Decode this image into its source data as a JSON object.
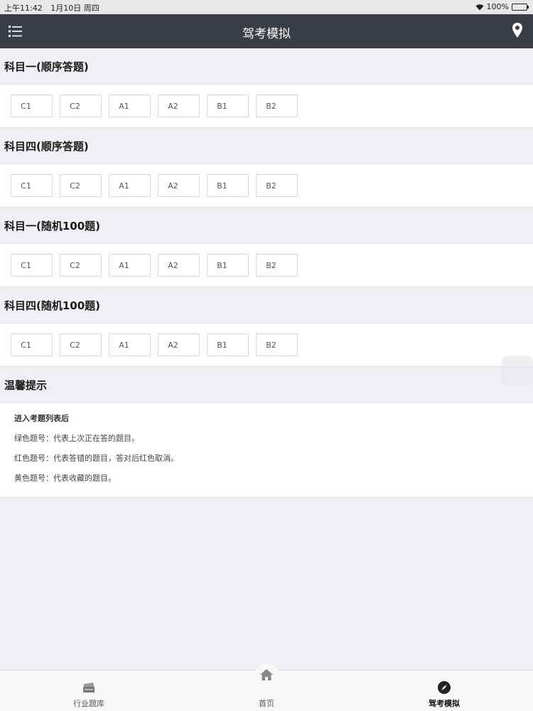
{
  "status_bar": {
    "time": "上午11:42",
    "date": "1月10日 周四",
    "battery": "100%"
  },
  "nav": {
    "title": "驾考模拟"
  },
  "sections": [
    {
      "title": "科目一(顺序答题)",
      "grades": [
        "C1",
        "C2",
        "A1",
        "A2",
        "B1",
        "B2"
      ]
    },
    {
      "title": "科目四(顺序答题)",
      "grades": [
        "C1",
        "C2",
        "A1",
        "A2",
        "B1",
        "B2"
      ]
    },
    {
      "title": "科目一(随机100题)",
      "grades": [
        "C1",
        "C2",
        "A1",
        "A2",
        "B1",
        "B2"
      ]
    },
    {
      "title": "科目四(随机100题)",
      "grades": [
        "C1",
        "C2",
        "A1",
        "A2",
        "B1",
        "B2"
      ]
    }
  ],
  "tips": {
    "title": "温馨提示",
    "lines": [
      "进入考题列表后",
      "绿色题号：代表上次正在答的题目。",
      "红色题号：代表答错的题目，答对后红色取消。",
      "黄色题号：代表收藏的题目。"
    ]
  },
  "tab_bar": {
    "tabs": [
      {
        "label": "行业题库",
        "icon": "cards-icon"
      },
      {
        "label": "首页",
        "icon": "home-icon"
      },
      {
        "label": "驾考模拟",
        "icon": "compass-icon"
      }
    ],
    "active_index": 2
  },
  "colors": {
    "nav_background": "#3a3d45",
    "page_background": "#efeff4",
    "battery_green": "#2fbf3a"
  }
}
